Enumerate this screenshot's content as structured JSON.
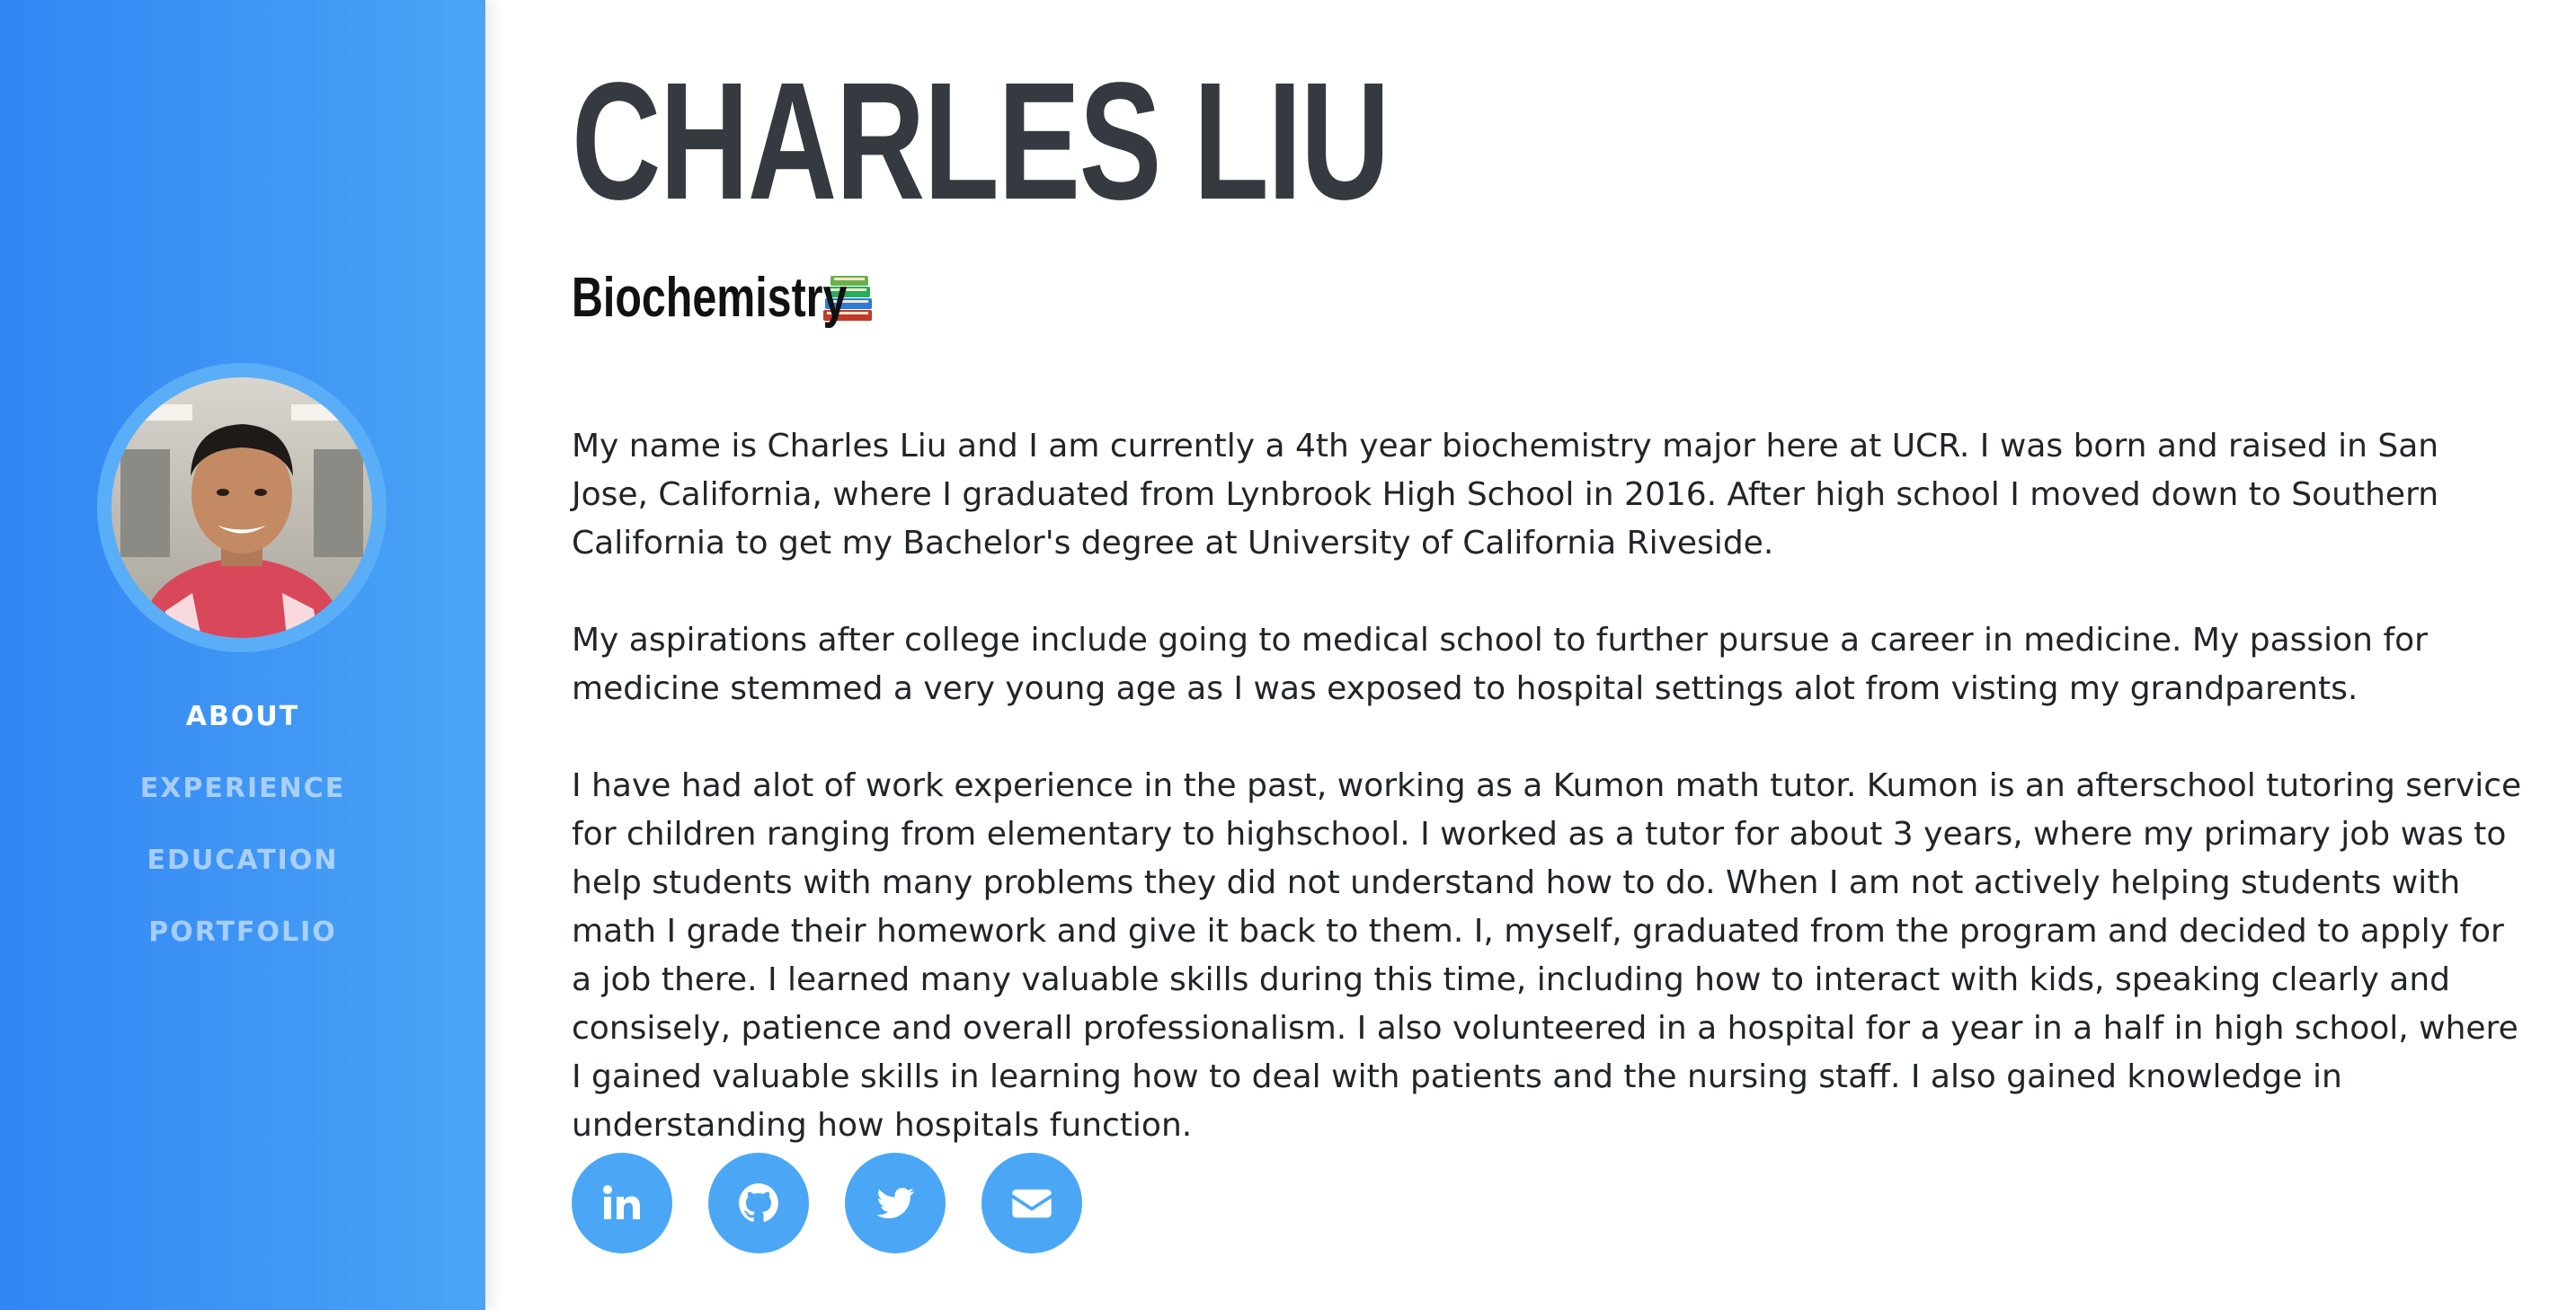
{
  "sidebar": {
    "avatar_alt": "Profile photo of Charles Liu",
    "nav": [
      {
        "label": "ABOUT",
        "active": true
      },
      {
        "label": "EXPERIENCE",
        "active": false
      },
      {
        "label": "EDUCATION",
        "active": false
      },
      {
        "label": "PORTFOLIO",
        "active": false
      }
    ]
  },
  "main": {
    "name": "CHARLES LIU",
    "subtitle": "Biochemistry",
    "subtitle_icon": "books-icon",
    "paragraphs": [
      "My name is Charles Liu and I am currently a 4th year biochemistry major here at UCR. I was born and raised in San Jose, California, where I graduated from Lynbrook High School in 2016. After high school I moved down to Southern California to get my Bachelor's degree at University of California Riveside.",
      "My aspirations after college include going to medical school to further pursue a career in medicine. My passion for medicine stemmed a very young age as I was exposed to hospital settings alot from visting my grandparents.",
      "I have had alot of work experience in the past, working as a Kumon math tutor. Kumon is an afterschool tutoring service for children ranging from elementary to highschool. I worked as a tutor for about 3 years, where my primary job was to help students with many problems they did not understand how to do. When I am not actively helping students with math I grade their homework and give it back to them. I, myself, graduated from the program and decided to apply for a job there. I learned many valuable skills during this time, including how to interact with kids, speaking clearly and consisely, patience and overall professionalism. I also volunteered in a hospital for a year in a half in high school, where I gained valuable skills in learning how to deal with patients and the nursing staff. I also gained knowledge in understanding how hospitals function."
    ],
    "socials": [
      {
        "icon": "linkedin-icon"
      },
      {
        "icon": "github-icon"
      },
      {
        "icon": "twitter-icon"
      },
      {
        "icon": "email-icon"
      }
    ]
  },
  "colors": {
    "sidebar_start": "#3286f4",
    "sidebar_end": "#4aa4f5",
    "social_bg": "#4ba7f5",
    "heading": "#343a40",
    "body_text": "#212529"
  }
}
